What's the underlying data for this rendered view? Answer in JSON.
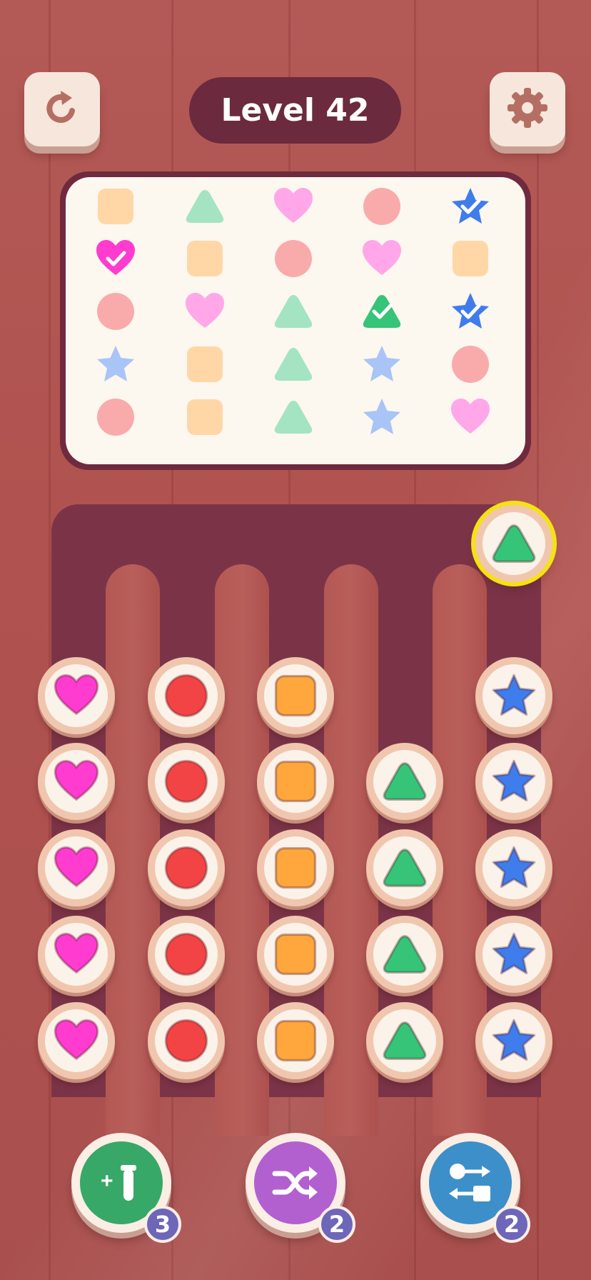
{
  "header": {
    "level_label": "Level 42",
    "restart_icon": "restart-icon",
    "settings_icon": "gear-icon"
  },
  "colors": {
    "heart": "#ff3ccf",
    "circle": "#f24444",
    "square": "#ffa73c",
    "triangle": "#35c478",
    "star": "#3f7cec",
    "board": "#7b3447"
  },
  "goal_grid": [
    [
      {
        "shape": "square",
        "done": false
      },
      {
        "shape": "triangle",
        "done": false
      },
      {
        "shape": "heart",
        "done": false
      },
      {
        "shape": "circle",
        "done": false
      },
      {
        "shape": "star",
        "done": true
      }
    ],
    [
      {
        "shape": "heart",
        "done": true
      },
      {
        "shape": "square",
        "done": false
      },
      {
        "shape": "circle",
        "done": false
      },
      {
        "shape": "heart",
        "done": false
      },
      {
        "shape": "square",
        "done": false
      }
    ],
    [
      {
        "shape": "circle",
        "done": false
      },
      {
        "shape": "heart",
        "done": false
      },
      {
        "shape": "triangle",
        "done": false
      },
      {
        "shape": "triangle",
        "done": true
      },
      {
        "shape": "star",
        "done": true
      }
    ],
    [
      {
        "shape": "star",
        "done": false
      },
      {
        "shape": "square",
        "done": false
      },
      {
        "shape": "triangle",
        "done": false
      },
      {
        "shape": "star",
        "done": false
      },
      {
        "shape": "circle",
        "done": false
      }
    ],
    [
      {
        "shape": "circle",
        "done": false
      },
      {
        "shape": "square",
        "done": false
      },
      {
        "shape": "triangle",
        "done": false
      },
      {
        "shape": "star",
        "done": false
      },
      {
        "shape": "heart",
        "done": false
      }
    ]
  ],
  "columns": [
    {
      "shape": "heart",
      "count": 5
    },
    {
      "shape": "circle",
      "count": 5
    },
    {
      "shape": "square",
      "count": 5
    },
    {
      "shape": "triangle",
      "count": 4
    },
    {
      "shape": "star",
      "count": 5
    }
  ],
  "held_piece": {
    "shape": "triangle",
    "column": 4
  },
  "boosters": [
    {
      "name": "add-tube",
      "icon": "add-tube-icon",
      "count": "3",
      "color": "#37a867"
    },
    {
      "name": "shuffle",
      "icon": "shuffle-icon",
      "count": "2",
      "color": "#b25fd0"
    },
    {
      "name": "swap",
      "icon": "swap-icon",
      "count": "2",
      "color": "#3d8fc9"
    }
  ]
}
